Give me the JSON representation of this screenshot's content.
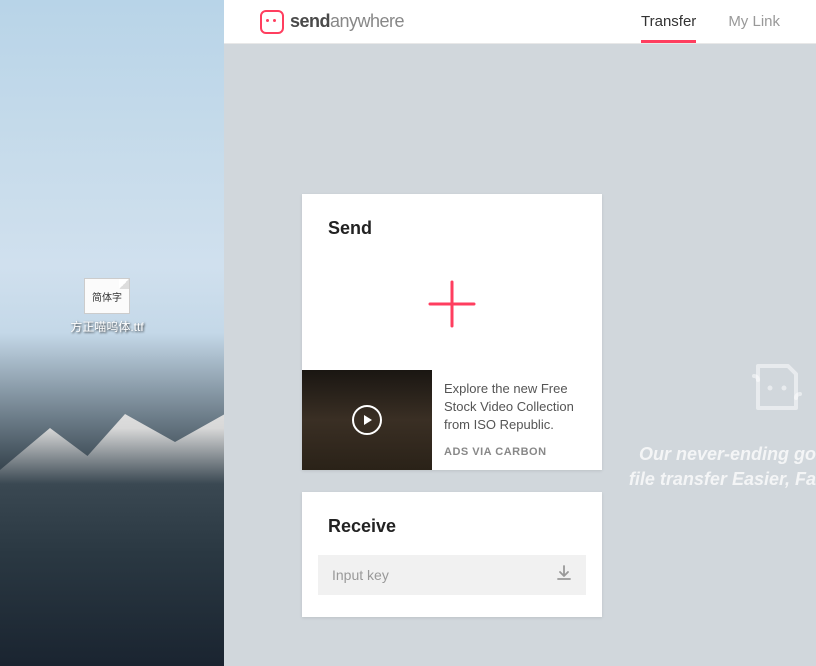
{
  "desktop": {
    "file": {
      "icon_text": "简体字",
      "label": "方正喵呜体.ttf"
    }
  },
  "app": {
    "logo": {
      "bold": "send",
      "light": "anywhere"
    },
    "nav": {
      "tabs": [
        {
          "label": "Transfer",
          "active": true
        },
        {
          "label": "My Link",
          "active": false
        }
      ]
    },
    "send": {
      "title": "Send"
    },
    "ad": {
      "text": "Explore the new Free Stock Video Collection from ISO Republic.",
      "via": "ADS VIA CARBON"
    },
    "receive": {
      "title": "Receive",
      "placeholder": "Input key"
    },
    "promo": {
      "line1": "Our never-ending go",
      "line2": "file transfer Easier, Fa"
    },
    "colors": {
      "accent": "#ff3e5f"
    }
  }
}
